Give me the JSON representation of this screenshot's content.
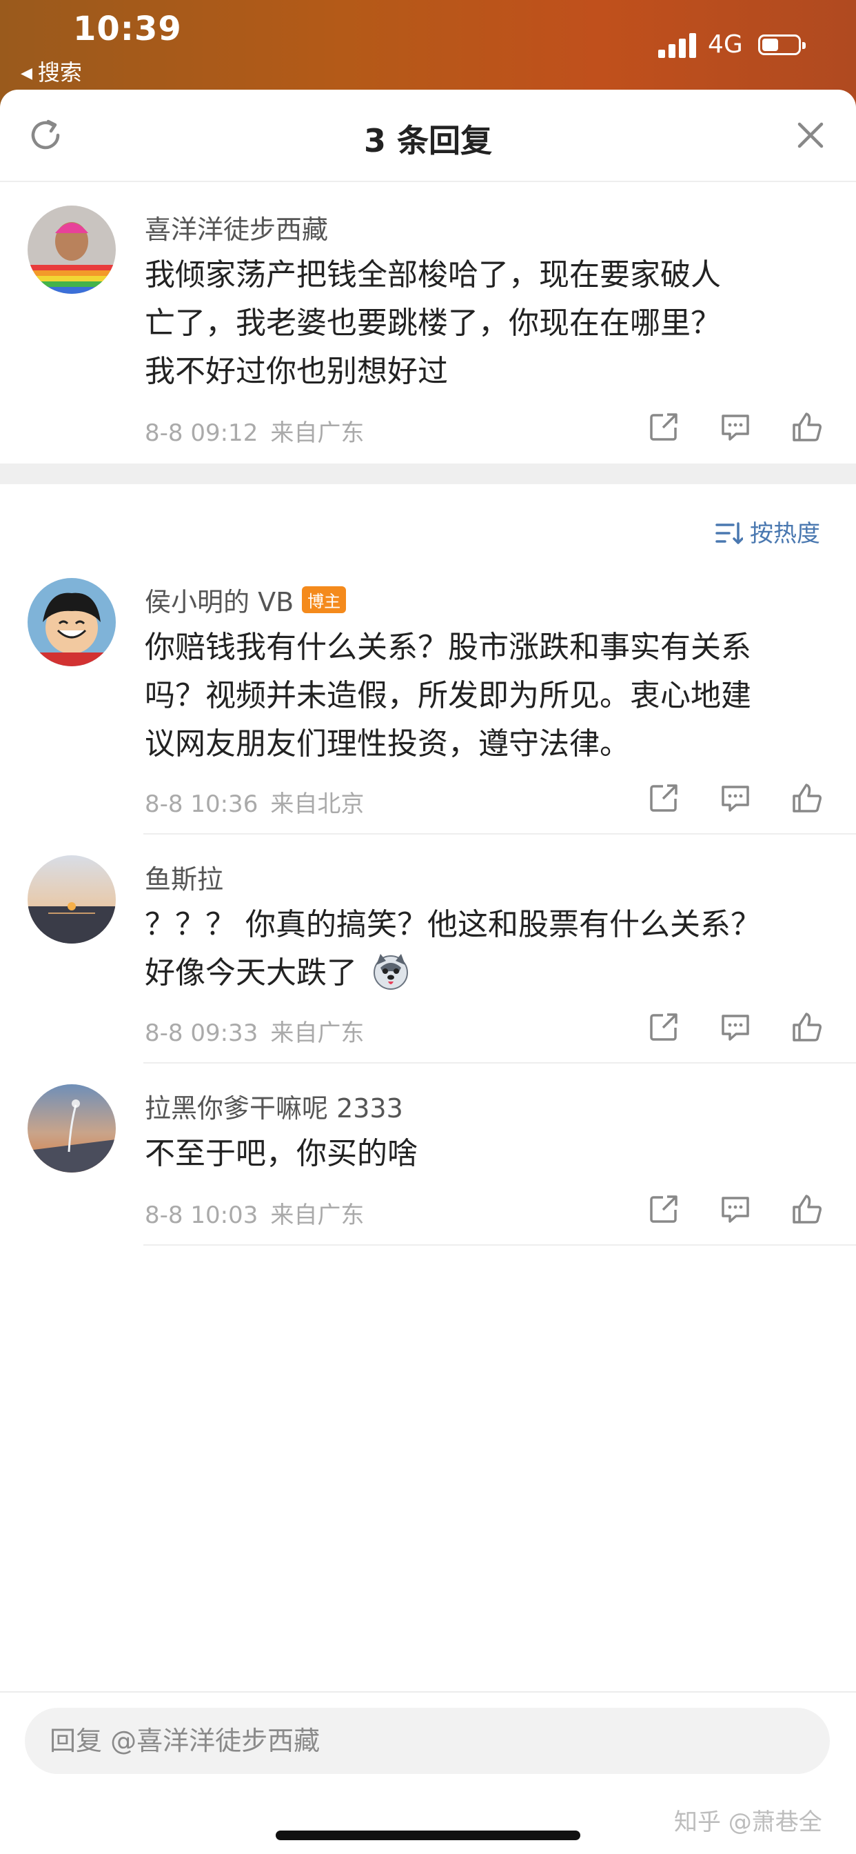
{
  "status_bar": {
    "time": "10:39",
    "back_app": "搜索",
    "network": "4G",
    "battery_level": 0.45
  },
  "header": {
    "title": "3 条回复",
    "refresh_icon": "refresh-icon",
    "close_icon": "close-icon"
  },
  "root_comment": {
    "author": "喜洋洋徒步西藏",
    "lines": [
      "我倾家荡产把钱全部梭哈了，现在要家破人",
      "亡了，我老婆也要跳楼了，你现在在哪里？",
      "我不好过你也别想好过"
    ],
    "date": "8-8 09:12",
    "location": "来自广东"
  },
  "sort": {
    "label": "按热度",
    "icon": "sort-icon"
  },
  "replies": [
    {
      "author": "侯小明的 VB",
      "badge": "博主",
      "lines": [
        "你赔钱我有什么关系？股市涨跌和事实有关系",
        "吗？视频并未造假，所发即为所见。衷心地建",
        "议网友朋友们理性投资，遵守法律。"
      ],
      "date": "8-8 10:36",
      "location": "来自北京"
    },
    {
      "author": "鱼斯拉",
      "lines": [
        "？？？ 你真的搞笑？他这和股票有什么关系？",
        "好像今天大跌了"
      ],
      "emoji": "husky-emoji",
      "date": "8-8 09:33",
      "location": "来自广东"
    },
    {
      "author": "拉黑你爹干嘛呢 2333",
      "lines": [
        "不至于吧，你买的啥"
      ],
      "date": "8-8 10:03",
      "location": "来自广东"
    }
  ],
  "action_icons": [
    "share-icon",
    "comment-icon",
    "like-icon"
  ],
  "reply_bar": {
    "placeholder": "回复 @喜洋洋徒步西藏"
  },
  "watermark": "知乎 @萧巷全",
  "colors": {
    "accent_blue": "#4a78b0",
    "badge_orange": "#f48a1c",
    "status_bar_bg": "#b45a18"
  }
}
